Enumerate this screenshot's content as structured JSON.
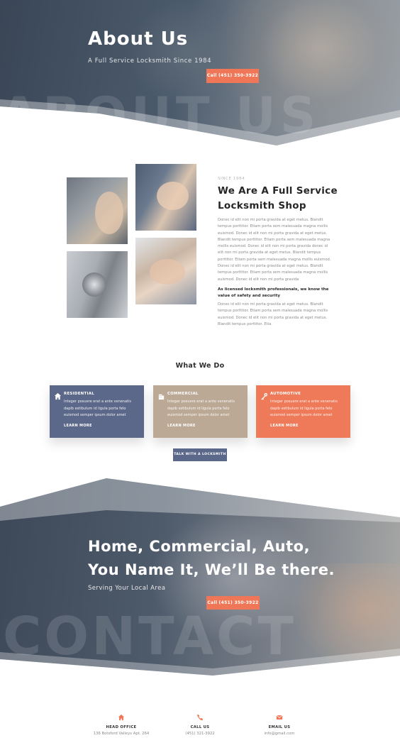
{
  "hero": {
    "title": "About Us",
    "subtitle": "A Full Service Locksmith Since 1984",
    "cta": "Call (451) 350-3922",
    "watermark": "ABOUT US"
  },
  "about": {
    "eyebrow": "SINCE 1984",
    "heading": "We Are A Full Service Locksmith Shop",
    "para1": "Donec id elit non mi porta gravida at eget metus. Blandit tempus porttitor. Etiam porta sem malesuada magna mollis euismod. Donec id elit non mi porta gravida at eget metus. Blandit tempus porttitor. Etiam porta sem malesuada magna mollis euismod. Donec id elit non mi porta gravida donec id elit non mi porta gravida at eget metus. Blandit tempus porttitor. Etiam porta sem malesuada magna mollis euismod. Donec id elit non mi porta gravida at eget metus. Blandit tempus porttitor. Etiam porta sem malesuada magna mollis euismod. Donec id elit non mi porta gravida",
    "bold": "As licensed locksmith professionals, we know the value of safety and security",
    "para2": "Donec id elit non mi porta gravida at eget metus. Blandit tempus porttitor. Etiam porta sem malesuada magna mollis euismod. Donec id elit non mi porta gravida at eget metus. Blandit tempus porttitor. Etia"
  },
  "services": {
    "heading": "What We Do",
    "cards": [
      {
        "title": "RESIDENTIAL",
        "desc": "Integer posuere erat a ante venenatis dapib estibulum id ligula porta felo euismod semper ipsum dolor amet",
        "link": "LEARN MORE",
        "icon": "home-icon",
        "color": "#5c6889"
      },
      {
        "title": "COMMERCIAL",
        "desc": "Integer posuere erat a ante venenatis dapib estibulum id ligula porta felo euismod semper ipsum dolor amet",
        "link": "LEARN MORE",
        "icon": "building-icon",
        "color": "#bba996"
      },
      {
        "title": "AUTOMOTIVE",
        "desc": "Integer posuere erat a ante venenatis dapib estibulum id ligula porta felo euismod semper ipsum dolor amet",
        "link": "LEARN MORE",
        "icon": "key-icon",
        "color": "#ef7a59"
      }
    ],
    "cta": "TALK WITH A LOCKSMITH"
  },
  "contact_band": {
    "heading_line1": "Home, Commercial, Auto,",
    "heading_line2": "You Name It, We’ll Be there.",
    "subtitle": "Serving Your Local Area",
    "cta": "Call (451) 350-3922",
    "watermark": "CONTACT"
  },
  "info": [
    {
      "label": "HEAD OFFICE",
      "value": "136 Botsford Valleys Apt. 264",
      "icon": "home-icon"
    },
    {
      "label": "CALL US",
      "value": "(451) 321-3922",
      "icon": "phone-icon"
    },
    {
      "label": "EMAIL US",
      "value": "info@gmail.com",
      "icon": "mail-icon"
    }
  ],
  "colors": {
    "accent": "#ef7656",
    "navy": "#5c6889",
    "tan": "#bba996"
  }
}
